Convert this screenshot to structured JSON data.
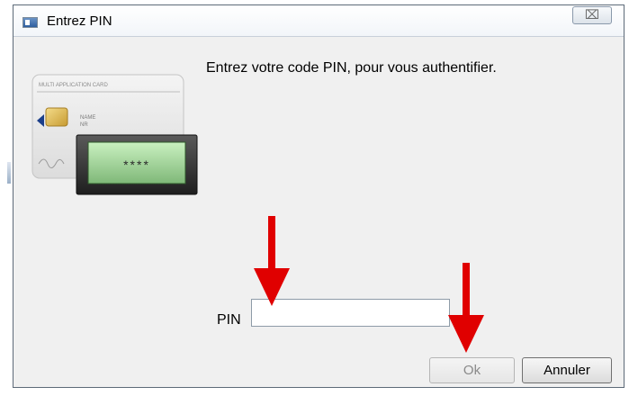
{
  "window": {
    "title": "Entrez PIN",
    "close_glyph": "⌧"
  },
  "prompt": "Entrez votre code PIN, pour vous authentifier.",
  "card": {
    "header": "MULTI APPLICATION CARD",
    "name_label": "NAME",
    "nr_label": "NR",
    "pin_mask": "****"
  },
  "pin": {
    "label": "PIN",
    "value": ""
  },
  "buttons": {
    "ok": "Ok",
    "cancel": "Annuler"
  },
  "annotation_color": "#e00000"
}
